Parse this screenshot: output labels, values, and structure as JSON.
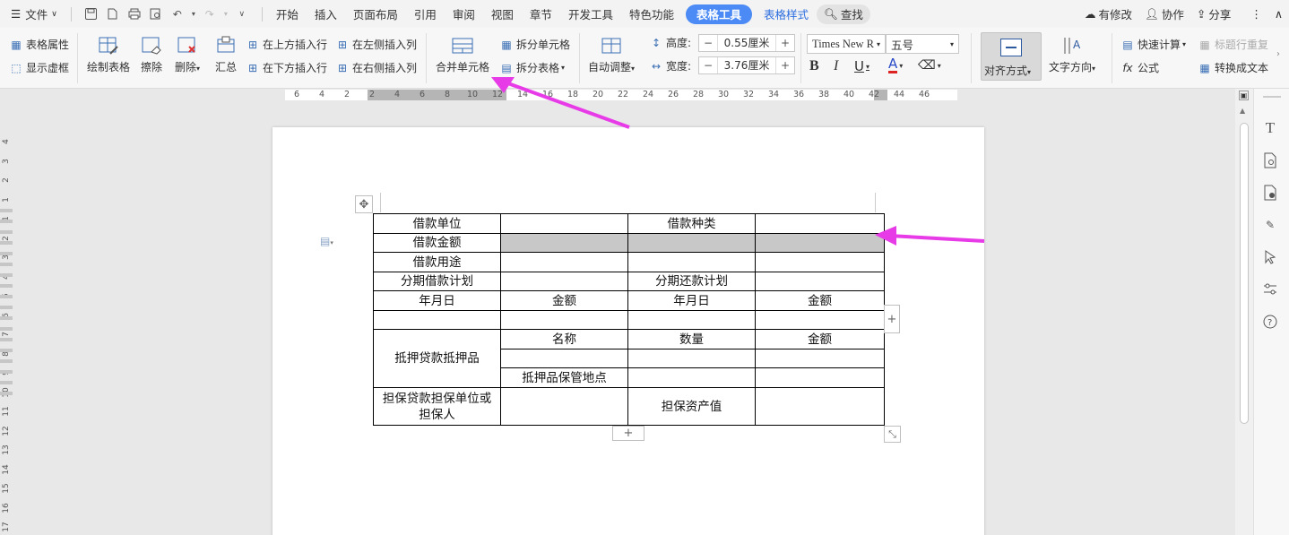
{
  "menubar": {
    "file": "文件",
    "items": [
      "开始",
      "插入",
      "页面布局",
      "引用",
      "审阅",
      "视图",
      "章节",
      "开发工具",
      "特色功能"
    ],
    "context_tabs": [
      "表格工具",
      "表格样式"
    ],
    "search": "查找",
    "right": [
      "有修改",
      "协作",
      "分享"
    ]
  },
  "ribbon": {
    "table_props": "表格属性",
    "show_gridlines": "显示虚框",
    "draw_table": "绘制表格",
    "erase": "擦除",
    "delete": "删除",
    "summary": "汇总",
    "insert_above": "在上方插入行",
    "insert_below": "在下方插入行",
    "insert_left": "在左侧插入列",
    "insert_right": "在右侧插入列",
    "merge_cells": "合并单元格",
    "split_cells": "拆分单元格",
    "split_table": "拆分表格",
    "auto_fit": "自动调整",
    "height_label": "高度:",
    "height_value": "0.55厘米",
    "width_label": "宽度:",
    "width_value": "3.76厘米",
    "font_name": "Times New R",
    "font_size": "五号",
    "align": "对齐方式",
    "text_dir": "文字方向",
    "quick_calc": "快速计算",
    "formula": "公式",
    "repeat_header": "标题行重复",
    "to_text": "转换成文本",
    "bold": "B",
    "italic": "I",
    "underline": "U",
    "fontcolor": "A"
  },
  "ruler": {
    "ticks": [
      "6",
      "4",
      "2",
      "2",
      "4",
      "6",
      "8",
      "10",
      "12",
      "14",
      "16",
      "18",
      "20",
      "22",
      "24",
      "26",
      "28",
      "30",
      "32",
      "34",
      "36",
      "38",
      "40",
      "42",
      "44",
      "46"
    ],
    "vticks": [
      "4",
      "3",
      "2",
      "1",
      "1",
      "2",
      "3",
      "4",
      "5",
      "6",
      "7",
      "8",
      "9",
      "10",
      "11",
      "12",
      "13",
      "14",
      "15",
      "16",
      "17"
    ]
  },
  "table": {
    "rows": [
      [
        "借款单位",
        "",
        "借款种类",
        ""
      ],
      [
        "借款金额",
        "",
        "",
        ""
      ],
      [
        "借款用途",
        "",
        "",
        ""
      ],
      [
        "分期借款计划",
        "",
        "分期还款计划",
        ""
      ],
      [
        "年月日",
        "金额",
        "年月日",
        "金额"
      ],
      [
        "",
        "",
        "",
        ""
      ]
    ],
    "collateral_label": "抵押贷款抵押品",
    "collateral_rows": [
      [
        "名称",
        "数量",
        "金额"
      ],
      [
        "",
        "",
        ""
      ],
      [
        "抵押品保管地点",
        "",
        ""
      ]
    ],
    "guarantor_label": "担保贷款担保单位或担保人",
    "guarantor_asset": "担保资产值"
  },
  "colors": {
    "accent": "#4c8bf5",
    "selection": "#c8c8c8",
    "arrow": "#e83be8"
  }
}
